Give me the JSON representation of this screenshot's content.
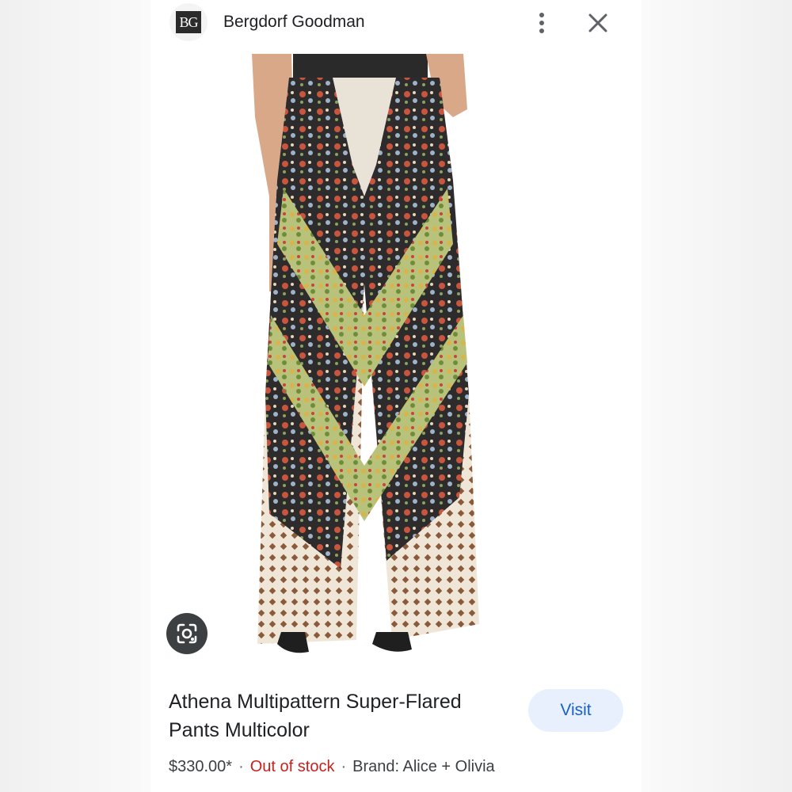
{
  "header": {
    "logo_text": "BG",
    "source_name": "Bergdorf Goodman"
  },
  "product": {
    "title": "Athena Multipattern Super-Flared Pants Multicolor",
    "price": "$330.00*",
    "stock_status": "Out of stock",
    "brand": "Brand: Alice + Olivia",
    "separator": "·"
  },
  "actions": {
    "visit_label": "Visit"
  },
  "icons": {
    "more": "more-vert-icon",
    "close": "close-icon",
    "lens": "google-lens-icon"
  },
  "colors": {
    "accent": "#1a5fc6",
    "button_bg": "#e8f0fe",
    "out_of_stock": "#c5221f"
  }
}
